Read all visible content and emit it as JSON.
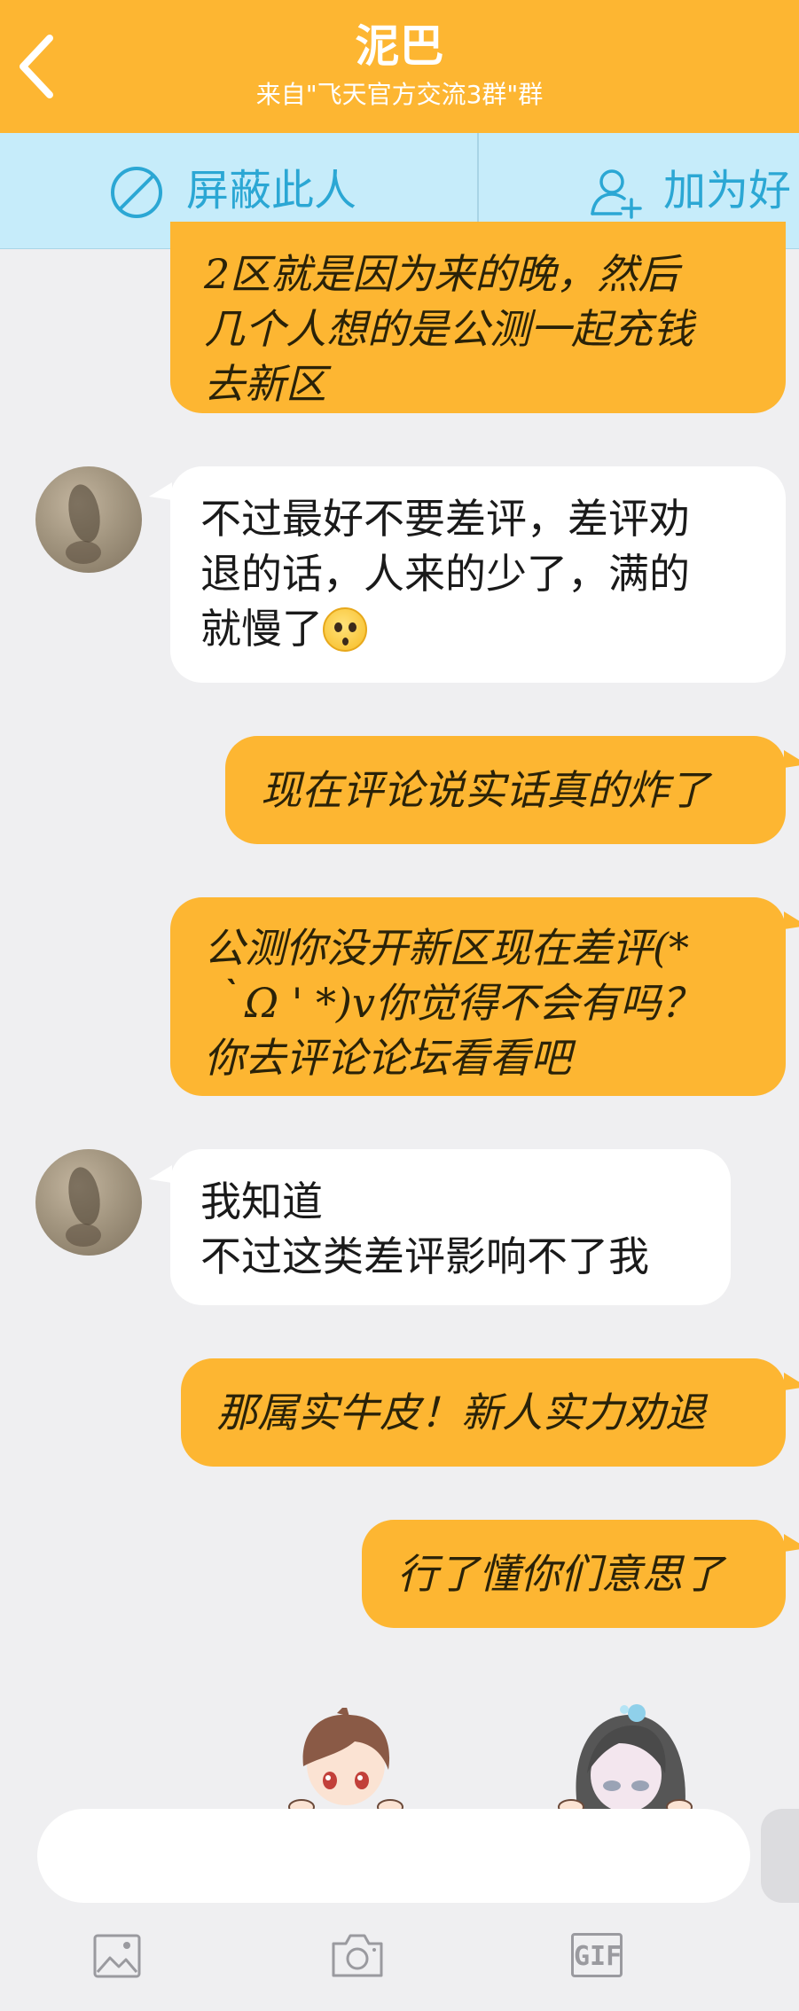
{
  "header": {
    "title": "泥巴",
    "subtitle": "来自\"飞天官方交流3群\"群",
    "background_color": "#fdb632"
  },
  "actions": {
    "block_label": "屏蔽此人",
    "add_friend_label": "加为好",
    "block_icon": "block-icon",
    "add_friend_icon": "add-friend-icon"
  },
  "messages": [
    {
      "side": "right",
      "text": "2区就是因为来的晚，然后\n几个人想的是公测一起充钱\n去新区"
    },
    {
      "side": "left",
      "text": "不过最好不要差评，差评劝\n退的话，人来的少了，满的\n就慢了",
      "emoji": "sweat-emoji"
    },
    {
      "side": "right",
      "text": "现在评论说实话真的炸了"
    },
    {
      "side": "right",
      "text": "公测你没开新区现在差评(*\n｀Ω ' *)v你觉得不会有吗？\n你去评论论坛看看吧"
    },
    {
      "side": "left",
      "text": "我知道\n不过这类差评影响不了我"
    },
    {
      "side": "right",
      "text": "那属实牛皮！新人实力劝退"
    },
    {
      "side": "right",
      "text": "行了懂你们意思了"
    }
  ],
  "input": {
    "placeholder": ""
  },
  "toolbar": {
    "image_icon": "image-icon",
    "camera_icon": "camera-icon",
    "gif_label": "GIF"
  },
  "colors": {
    "own_bubble": "#fdb632",
    "other_bubble": "#ffffff",
    "action_bar": "#c6ecfa",
    "action_text": "#2ba7d4"
  }
}
